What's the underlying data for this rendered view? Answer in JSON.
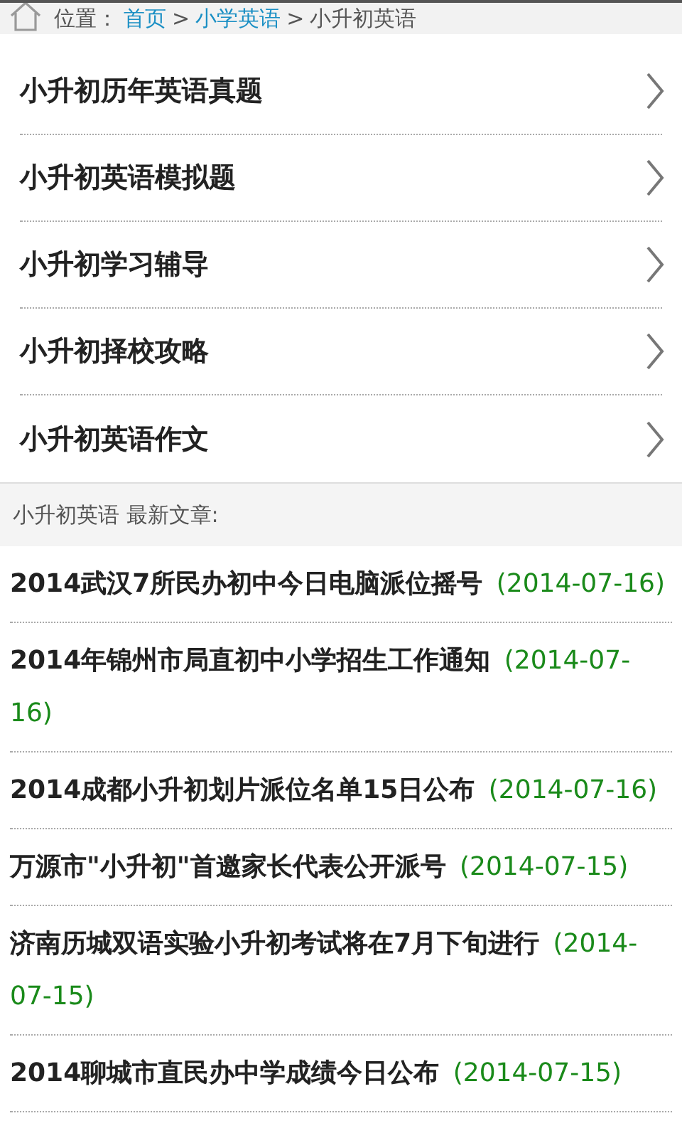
{
  "breadcrumb": {
    "label": "位置：",
    "links": [
      "首页",
      "小学英语"
    ],
    "separator": ">",
    "current": "小升初英语"
  },
  "nav_items": [
    {
      "label": "小升初历年英语真题"
    },
    {
      "label": "小升初英语模拟题"
    },
    {
      "label": "小升初学习辅导"
    },
    {
      "label": "小升初择校攻略"
    },
    {
      "label": "小升初英语作文"
    }
  ],
  "section_header": "小升初英语 最新文章:",
  "articles": [
    {
      "title": "2014武汉7所民办初中今日电脑派位摇号",
      "date": "(2014-07-16)"
    },
    {
      "title": "2014年锦州市局直初中小学招生工作通知",
      "date": "(2014-07-16)"
    },
    {
      "title": "2014成都小升初划片派位名单15日公布",
      "date": "(2014-07-16)"
    },
    {
      "title": "万源市\"小升初\"首邀家长代表公开派号",
      "date": "(2014-07-15)"
    },
    {
      "title": "济南历城双语实验小升初考试将在7月下旬进行",
      "date": "(2014-07-15)"
    },
    {
      "title": "2014聊城市直民办中学成绩今日公布",
      "date": "(2014-07-15)"
    }
  ]
}
